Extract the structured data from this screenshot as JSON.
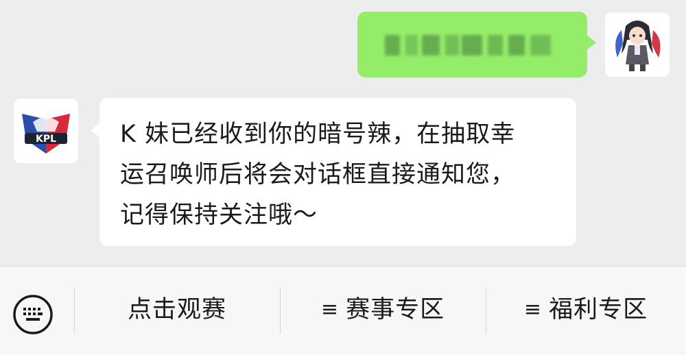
{
  "chat": {
    "outgoing": {
      "text_blurred": true
    },
    "incoming": {
      "sender_logo_text": "KPL",
      "lines": [
        "K 妹已经收到你的暗号辣，在抽取幸",
        "运召唤师后将会对话框直接通知您，",
        "记得保持关注哦～"
      ]
    }
  },
  "menu": {
    "keyboard_icon": "keyboard-icon",
    "items": [
      {
        "label": "点击观赛",
        "has_submenu": false
      },
      {
        "label": "赛事专区",
        "has_submenu": true,
        "icon": "≡"
      },
      {
        "label": "福利专区",
        "has_submenu": true,
        "icon": "≡"
      }
    ]
  },
  "colors": {
    "chat_bg": "#ededed",
    "outgoing_bubble": "#95ec69",
    "incoming_bubble": "#ffffff",
    "menubar_bg": "#f7f7f7",
    "kpl_red": "#d8283a",
    "kpl_blue": "#2a4fa8"
  }
}
